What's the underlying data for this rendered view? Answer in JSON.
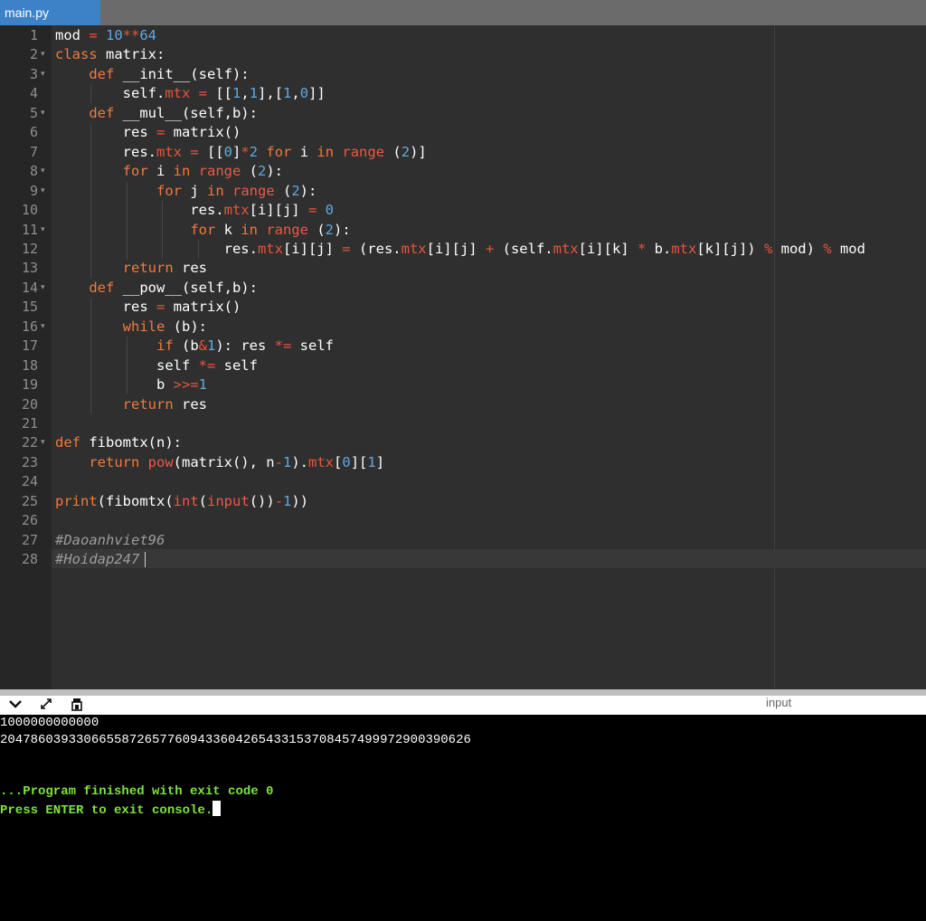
{
  "tab": {
    "filename": "main.py"
  },
  "editor": {
    "lines": [
      {
        "n": "1",
        "tokens": [
          [
            "mod",
            "t"
          ],
          [
            " = ",
            "op"
          ],
          [
            "10",
            "num"
          ],
          [
            "**",
            "op"
          ],
          [
            "64",
            "num"
          ]
        ]
      },
      {
        "n": "2",
        "fold": true,
        "tokens": [
          [
            "class ",
            "kw"
          ],
          [
            "matrix:",
            "t"
          ]
        ]
      },
      {
        "n": "3",
        "fold": true,
        "tokens": [
          [
            "    ",
            "t"
          ],
          [
            "def ",
            "kw"
          ],
          [
            "__init__(self):",
            "t"
          ]
        ]
      },
      {
        "n": "4",
        "tokens": [
          [
            "        self.",
            "t"
          ],
          [
            "mtx",
            "op"
          ],
          [
            " = ",
            "op"
          ],
          [
            "[[",
            "t"
          ],
          [
            "1",
            "num"
          ],
          [
            ",",
            "t"
          ],
          [
            "1",
            "num"
          ],
          [
            "],[",
            "t"
          ],
          [
            "1",
            "num"
          ],
          [
            ",",
            "t"
          ],
          [
            "0",
            "num"
          ],
          [
            "]]",
            "t"
          ]
        ]
      },
      {
        "n": "5",
        "fold": true,
        "tokens": [
          [
            "    ",
            "t"
          ],
          [
            "def ",
            "kw"
          ],
          [
            "__mul__(self,b):",
            "t"
          ]
        ]
      },
      {
        "n": "6",
        "tokens": [
          [
            "        res",
            "t"
          ],
          [
            " = ",
            "op"
          ],
          [
            "matrix()",
            "t"
          ]
        ]
      },
      {
        "n": "7",
        "tokens": [
          [
            "        res.",
            "t"
          ],
          [
            "mtx",
            "op"
          ],
          [
            " = ",
            "op"
          ],
          [
            "[[",
            "t"
          ],
          [
            "0",
            "num"
          ],
          [
            "]",
            "t"
          ],
          [
            "*",
            "op"
          ],
          [
            "2",
            "num"
          ],
          [
            " ",
            "t"
          ],
          [
            "for ",
            "kw"
          ],
          [
            "i ",
            "t"
          ],
          [
            "in ",
            "kw"
          ],
          [
            "range",
            "fn"
          ],
          [
            " (",
            "t"
          ],
          [
            "2",
            "num"
          ],
          [
            ")]",
            "t"
          ]
        ]
      },
      {
        "n": "8",
        "fold": true,
        "tokens": [
          [
            "        ",
            "t"
          ],
          [
            "for ",
            "kw"
          ],
          [
            "i ",
            "t"
          ],
          [
            "in ",
            "kw"
          ],
          [
            "range",
            "fn"
          ],
          [
            " (",
            "t"
          ],
          [
            "2",
            "num"
          ],
          [
            "):",
            "t"
          ]
        ]
      },
      {
        "n": "9",
        "fold": true,
        "tokens": [
          [
            "            ",
            "t"
          ],
          [
            "for ",
            "kw"
          ],
          [
            "j ",
            "t"
          ],
          [
            "in ",
            "kw"
          ],
          [
            "range",
            "fn"
          ],
          [
            " (",
            "t"
          ],
          [
            "2",
            "num"
          ],
          [
            "):",
            "t"
          ]
        ]
      },
      {
        "n": "10",
        "tokens": [
          [
            "                res.",
            "t"
          ],
          [
            "mtx",
            "op"
          ],
          [
            "[i][j]",
            "t"
          ],
          [
            " = ",
            "op"
          ],
          [
            "0",
            "num"
          ]
        ]
      },
      {
        "n": "11",
        "fold": true,
        "tokens": [
          [
            "                ",
            "t"
          ],
          [
            "for ",
            "kw"
          ],
          [
            "k ",
            "t"
          ],
          [
            "in ",
            "kw"
          ],
          [
            "range",
            "fn"
          ],
          [
            " (",
            "t"
          ],
          [
            "2",
            "num"
          ],
          [
            "):",
            "t"
          ]
        ]
      },
      {
        "n": "12",
        "tokens": [
          [
            "                    res.",
            "t"
          ],
          [
            "mtx",
            "op"
          ],
          [
            "[i][j]",
            "t"
          ],
          [
            " = ",
            "op"
          ],
          [
            "(res.",
            "t"
          ],
          [
            "mtx",
            "op"
          ],
          [
            "[i][j]",
            "t"
          ],
          [
            " + ",
            "op"
          ],
          [
            "(self.",
            "t"
          ],
          [
            "mtx",
            "op"
          ],
          [
            "[i][k]",
            "t"
          ],
          [
            " * ",
            "op"
          ],
          [
            "b.",
            "t"
          ],
          [
            "mtx",
            "op"
          ],
          [
            "[k][j])",
            "t"
          ],
          [
            " % ",
            "op"
          ],
          [
            "mod)",
            "t"
          ],
          [
            " % ",
            "op"
          ],
          [
            "mod",
            "t"
          ]
        ]
      },
      {
        "n": "13",
        "tokens": [
          [
            "        ",
            "t"
          ],
          [
            "return ",
            "kw"
          ],
          [
            "res",
            "t"
          ]
        ]
      },
      {
        "n": "14",
        "fold": true,
        "tokens": [
          [
            "    ",
            "t"
          ],
          [
            "def ",
            "kw"
          ],
          [
            "__pow__(self,b):",
            "t"
          ]
        ]
      },
      {
        "n": "15",
        "tokens": [
          [
            "        res",
            "t"
          ],
          [
            " = ",
            "op"
          ],
          [
            "matrix()",
            "t"
          ]
        ]
      },
      {
        "n": "16",
        "fold": true,
        "tokens": [
          [
            "        ",
            "t"
          ],
          [
            "while ",
            "kw"
          ],
          [
            "(b):",
            "t"
          ]
        ]
      },
      {
        "n": "17",
        "tokens": [
          [
            "            ",
            "t"
          ],
          [
            "if ",
            "kw"
          ],
          [
            "(b",
            "t"
          ],
          [
            "&",
            "op"
          ],
          [
            "1",
            "num"
          ],
          [
            "): res ",
            "t"
          ],
          [
            "*=",
            "op"
          ],
          [
            " self",
            "t"
          ]
        ]
      },
      {
        "n": "18",
        "tokens": [
          [
            "            self ",
            "t"
          ],
          [
            "*=",
            "op"
          ],
          [
            " self",
            "t"
          ]
        ]
      },
      {
        "n": "19",
        "tokens": [
          [
            "            b ",
            "t"
          ],
          [
            ">>=",
            "op"
          ],
          [
            "1",
            "num"
          ]
        ]
      },
      {
        "n": "20",
        "tokens": [
          [
            "        ",
            "t"
          ],
          [
            "return ",
            "kw"
          ],
          [
            "res",
            "t"
          ]
        ]
      },
      {
        "n": "21",
        "tokens": []
      },
      {
        "n": "22",
        "fold": true,
        "tokens": [
          [
            "def ",
            "kw"
          ],
          [
            "fibomtx(n):",
            "t"
          ]
        ]
      },
      {
        "n": "23",
        "tokens": [
          [
            "    ",
            "t"
          ],
          [
            "return ",
            "kw"
          ],
          [
            "pow",
            "fn"
          ],
          [
            "(matrix(), n",
            "t"
          ],
          [
            "-",
            "op"
          ],
          [
            "1",
            "num"
          ],
          [
            ").",
            "t"
          ],
          [
            "mtx",
            "op"
          ],
          [
            "[",
            "t"
          ],
          [
            "0",
            "num"
          ],
          [
            "][",
            "t"
          ],
          [
            "1",
            "num"
          ],
          [
            "]",
            "t"
          ]
        ]
      },
      {
        "n": "24",
        "tokens": []
      },
      {
        "n": "25",
        "tokens": [
          [
            "print",
            "kw"
          ],
          [
            "(fibomtx(",
            "t"
          ],
          [
            "int",
            "fn"
          ],
          [
            "(",
            "t"
          ],
          [
            "input",
            "fn"
          ],
          [
            "())",
            "t"
          ],
          [
            "-",
            "op"
          ],
          [
            "1",
            "num"
          ],
          [
            "))",
            "t"
          ]
        ]
      },
      {
        "n": "26",
        "tokens": []
      },
      {
        "n": "27",
        "tokens": [
          [
            "#Daoanhviet96",
            "cm"
          ]
        ]
      },
      {
        "n": "28",
        "tokens": [
          [
            "#Hoidap247",
            "cm"
          ]
        ]
      }
    ]
  },
  "console_toolbar": {
    "collapse_icon": "chevron-down-icon",
    "expand_icon": "expand-arrows-icon",
    "clear_icon": "clear-console-icon",
    "input_label": "input"
  },
  "console": {
    "input_line": "1000000000000",
    "output_line": "2047860393306655872657760943360426543315370845749997290039062​6",
    "blank": "",
    "finished_line": "...Program finished with exit code 0",
    "press_line": "Press ENTER to exit console."
  }
}
